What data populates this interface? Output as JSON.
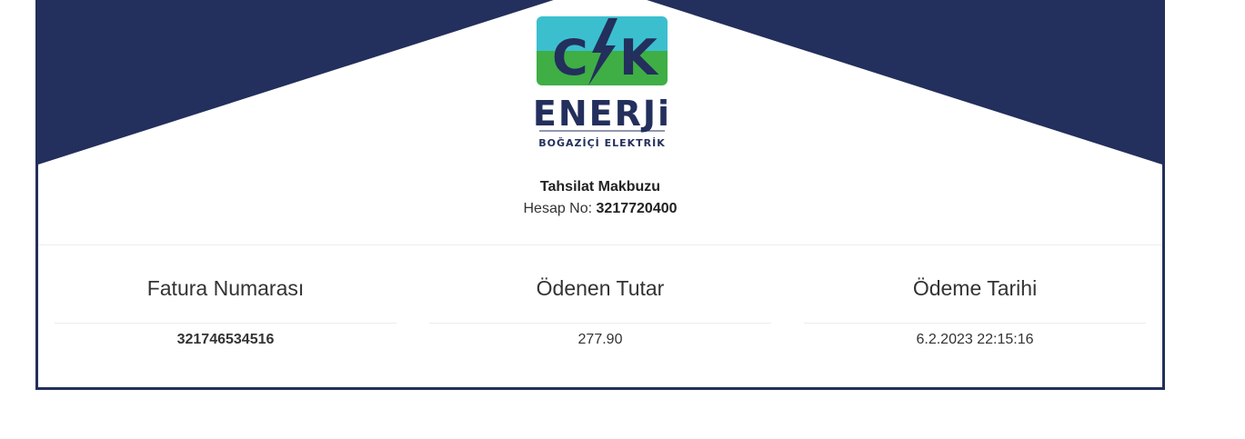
{
  "brand": {
    "logo_letters": "C/K",
    "logo_word": "ENERJi",
    "logo_sub": "BOĞAZİÇİ ELEKTRİK",
    "colors": {
      "navy": "#232f5c",
      "cyan": "#3bbfcf",
      "green": "#3fae45"
    }
  },
  "receipt": {
    "title": "Tahsilat Makbuzu",
    "account_label": "Hesap No:",
    "account_number": "3217720400"
  },
  "details": {
    "invoice_number_label": "Fatura Numarası",
    "invoice_number": "321746534516",
    "amount_label": "Ödenen Tutar",
    "amount": "277.90",
    "date_label": "Ödeme Tarihi",
    "date": "6.2.2023 22:15:16"
  }
}
